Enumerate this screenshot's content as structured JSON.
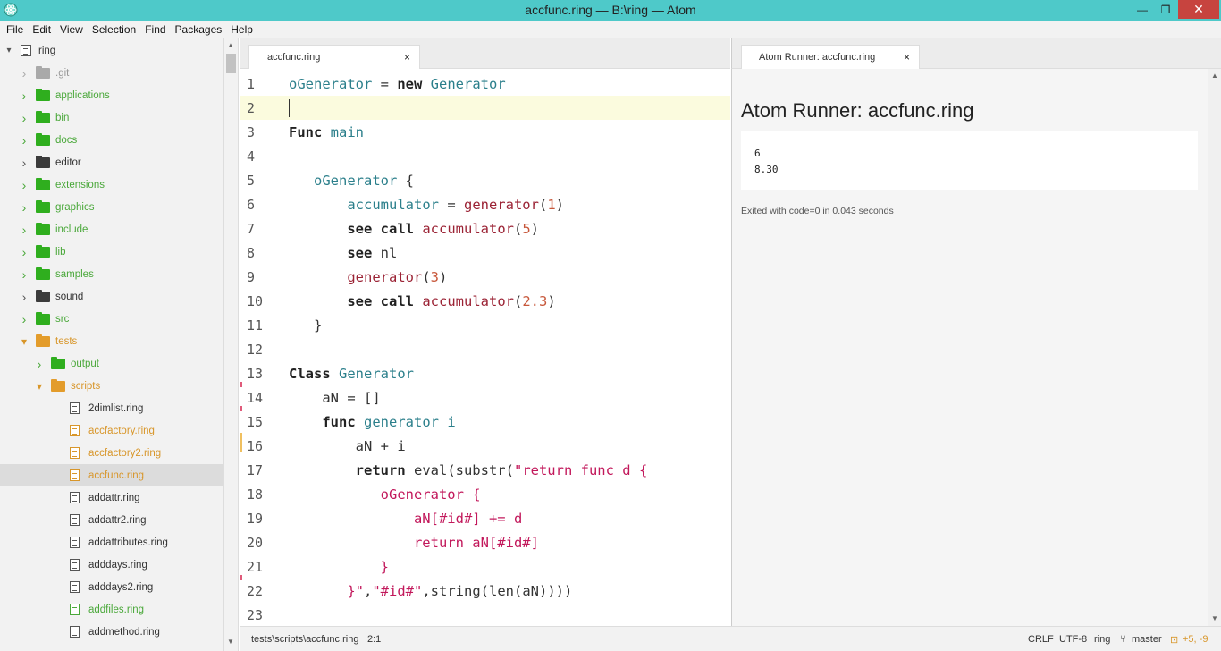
{
  "window": {
    "title": "accfunc.ring — B:\\ring — Atom",
    "minimize": "—",
    "maximize": "❐",
    "close": "✕"
  },
  "menu": [
    "File",
    "Edit",
    "View",
    "Selection",
    "Find",
    "Packages",
    "Help"
  ],
  "tree": {
    "root": "ring",
    "items": [
      {
        "label": ".git",
        "type": "folder",
        "state": "collapsed",
        "status": "ignored"
      },
      {
        "label": "applications",
        "type": "folder",
        "state": "collapsed",
        "status": "added"
      },
      {
        "label": "bin",
        "type": "folder",
        "state": "collapsed",
        "status": "added"
      },
      {
        "label": "docs",
        "type": "folder",
        "state": "collapsed",
        "status": "added"
      },
      {
        "label": "editor",
        "type": "folder",
        "state": "collapsed",
        "status": "normal"
      },
      {
        "label": "extensions",
        "type": "folder",
        "state": "collapsed",
        "status": "added"
      },
      {
        "label": "graphics",
        "type": "folder",
        "state": "collapsed",
        "status": "added"
      },
      {
        "label": "include",
        "type": "folder",
        "state": "collapsed",
        "status": "added"
      },
      {
        "label": "lib",
        "type": "folder",
        "state": "collapsed",
        "status": "added"
      },
      {
        "label": "samples",
        "type": "folder",
        "state": "collapsed",
        "status": "added"
      },
      {
        "label": "sound",
        "type": "folder",
        "state": "collapsed",
        "status": "normal"
      },
      {
        "label": "src",
        "type": "folder",
        "state": "collapsed",
        "status": "added"
      },
      {
        "label": "tests",
        "type": "folder",
        "state": "expanded",
        "status": "modified"
      },
      {
        "label": "output",
        "type": "folder",
        "state": "collapsed",
        "status": "added"
      },
      {
        "label": "scripts",
        "type": "folder",
        "state": "expanded",
        "status": "modified"
      },
      {
        "label": "2dimlist.ring",
        "type": "file",
        "status": "normal"
      },
      {
        "label": "accfactory.ring",
        "type": "file",
        "status": "modified"
      },
      {
        "label": "accfactory2.ring",
        "type": "file",
        "status": "modified"
      },
      {
        "label": "accfunc.ring",
        "type": "file",
        "status": "modified",
        "selected": true
      },
      {
        "label": "addattr.ring",
        "type": "file",
        "status": "normal"
      },
      {
        "label": "addattr2.ring",
        "type": "file",
        "status": "normal"
      },
      {
        "label": "addattributes.ring",
        "type": "file",
        "status": "normal"
      },
      {
        "label": "adddays.ring",
        "type": "file",
        "status": "normal"
      },
      {
        "label": "adddays2.ring",
        "type": "file",
        "status": "normal"
      },
      {
        "label": "addfiles.ring",
        "type": "file",
        "status": "added"
      },
      {
        "label": "addmethod.ring",
        "type": "file",
        "status": "normal"
      }
    ]
  },
  "editor": {
    "tab_label": "accfunc.ring",
    "tab_close": "×",
    "lines": [
      {
        "n": "1",
        "tokens": [
          [
            "var",
            "oGenerator"
          ],
          [
            "plain",
            " = "
          ],
          [
            "kw",
            "new"
          ],
          [
            "plain",
            " "
          ],
          [
            "cls",
            "Generator"
          ]
        ]
      },
      {
        "n": "2",
        "tokens": [],
        "current": true
      },
      {
        "n": "3",
        "tokens": [
          [
            "kw",
            "Func"
          ],
          [
            "plain",
            " "
          ],
          [
            "cls",
            "main"
          ]
        ]
      },
      {
        "n": "4",
        "tokens": []
      },
      {
        "n": "5",
        "tokens": [
          [
            "plain",
            "   "
          ],
          [
            "var",
            "oGenerator"
          ],
          [
            "plain",
            " {"
          ]
        ]
      },
      {
        "n": "6",
        "tokens": [
          [
            "plain",
            "       "
          ],
          [
            "var",
            "accumulator"
          ],
          [
            "plain",
            " = "
          ],
          [
            "fn",
            "generator"
          ],
          [
            "plain",
            "("
          ],
          [
            "num",
            "1"
          ],
          [
            "plain",
            ")"
          ]
        ]
      },
      {
        "n": "7",
        "tokens": [
          [
            "plain",
            "       "
          ],
          [
            "kw",
            "see call"
          ],
          [
            "plain",
            " "
          ],
          [
            "fn",
            "accumulator"
          ],
          [
            "plain",
            "("
          ],
          [
            "num",
            "5"
          ],
          [
            "plain",
            ")"
          ]
        ]
      },
      {
        "n": "8",
        "tokens": [
          [
            "plain",
            "       "
          ],
          [
            "kw",
            "see"
          ],
          [
            "plain",
            " nl"
          ]
        ]
      },
      {
        "n": "9",
        "tokens": [
          [
            "plain",
            "       "
          ],
          [
            "fn",
            "generator"
          ],
          [
            "plain",
            "("
          ],
          [
            "num",
            "3"
          ],
          [
            "plain",
            ")"
          ]
        ]
      },
      {
        "n": "10",
        "tokens": [
          [
            "plain",
            "       "
          ],
          [
            "kw",
            "see call"
          ],
          [
            "plain",
            " "
          ],
          [
            "fn",
            "accumulator"
          ],
          [
            "plain",
            "("
          ],
          [
            "num",
            "2.3"
          ],
          [
            "plain",
            ")"
          ]
        ]
      },
      {
        "n": "11",
        "tokens": [
          [
            "plain",
            "   }"
          ]
        ]
      },
      {
        "n": "12",
        "tokens": []
      },
      {
        "n": "13",
        "tokens": [
          [
            "kw",
            "Class"
          ],
          [
            "plain",
            " "
          ],
          [
            "cls",
            "Generator"
          ]
        ]
      },
      {
        "n": "14",
        "tokens": [
          [
            "plain",
            "    aN = []"
          ]
        ]
      },
      {
        "n": "15",
        "tokens": [
          [
            "plain",
            "    "
          ],
          [
            "kw",
            "func"
          ],
          [
            "plain",
            " "
          ],
          [
            "cls",
            "generator i"
          ]
        ]
      },
      {
        "n": "16",
        "tokens": [
          [
            "plain",
            "        aN + i"
          ]
        ]
      },
      {
        "n": "17",
        "tokens": [
          [
            "plain",
            "        "
          ],
          [
            "kw",
            "return"
          ],
          [
            "plain",
            " eval(substr("
          ],
          [
            "str",
            "\"return func d {"
          ]
        ]
      },
      {
        "n": "18",
        "tokens": [
          [
            "str",
            "           oGenerator {"
          ]
        ]
      },
      {
        "n": "19",
        "tokens": [
          [
            "str",
            "               aN[#id#] += d"
          ]
        ]
      },
      {
        "n": "20",
        "tokens": [
          [
            "str",
            "               return aN[#id#]"
          ]
        ]
      },
      {
        "n": "21",
        "tokens": [
          [
            "str",
            "           }"
          ]
        ]
      },
      {
        "n": "22",
        "tokens": [
          [
            "str",
            "       }\""
          ],
          [
            "plain",
            ","
          ],
          [
            "str",
            "\"#id#\""
          ],
          [
            "plain",
            ",string(len(aN))))"
          ]
        ]
      },
      {
        "n": "23",
        "tokens": []
      }
    ]
  },
  "runner": {
    "tab_label": "Atom Runner: accfunc.ring",
    "tab_close": "×",
    "title": "Atom Runner: accfunc.ring",
    "output": "6\n8.30",
    "exit_message": "Exited with code=0 in 0.043 seconds"
  },
  "status": {
    "path": "tests\\scripts\\accfunc.ring",
    "cursor": "2:1",
    "line_ending": "CRLF",
    "encoding": "UTF-8",
    "grammar": "ring",
    "branch": "master",
    "git_diff": "+5, -9"
  },
  "colors": {
    "titlebar": "#4ec9c9",
    "close_button": "#c7443f",
    "added": "#4aa83a",
    "modified": "#d8962a"
  }
}
